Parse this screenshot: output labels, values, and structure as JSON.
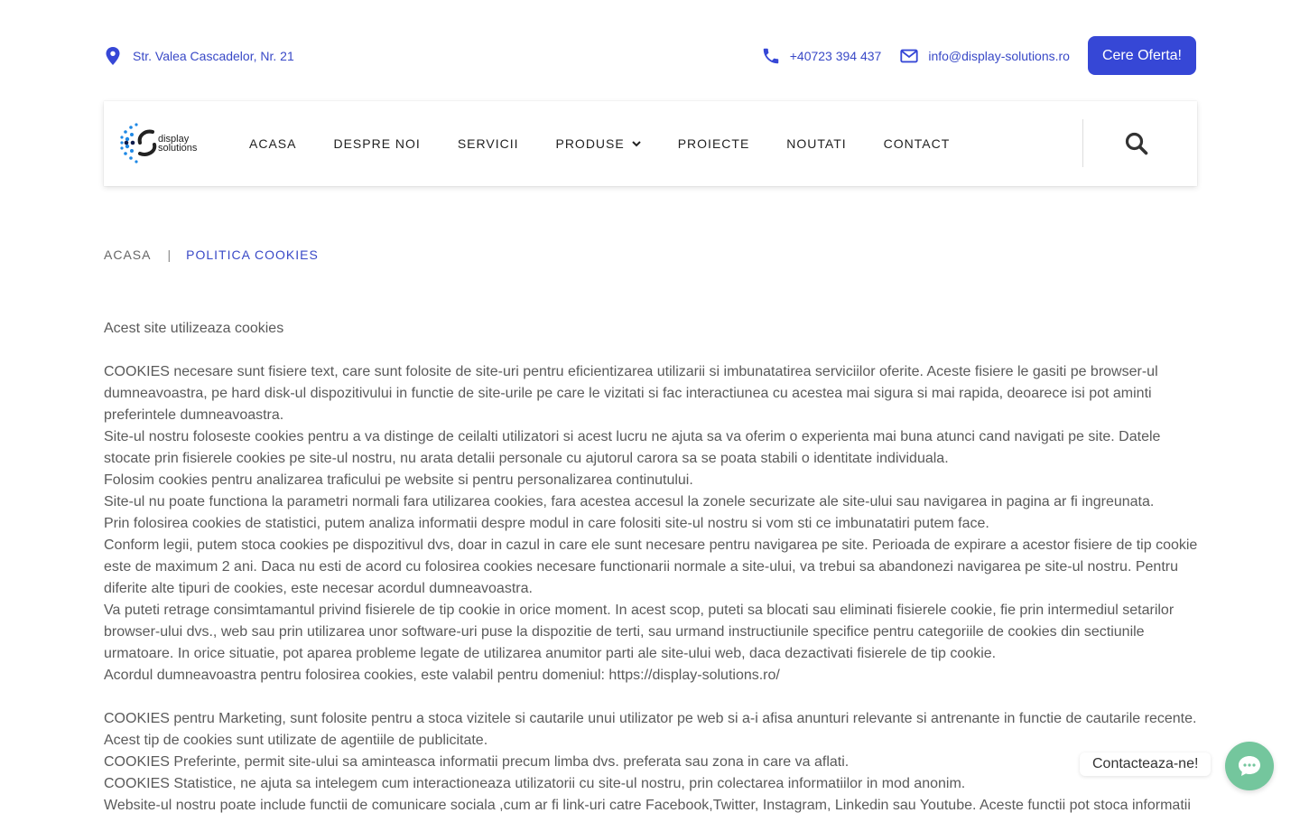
{
  "topbar": {
    "address": "Str. Valea Cascadelor, Nr. 21",
    "phone": "+40723 394 437",
    "email": "info@display-solutions.ro",
    "offer_button": "Cere Oferta!"
  },
  "logo": {
    "line1": "display",
    "line2": "solutions"
  },
  "nav": {
    "items": [
      "ACASA",
      "DESPRE NOI",
      "SERVICII",
      "PRODUSE",
      "PROIECTE",
      "NOUTATI",
      "CONTACT"
    ]
  },
  "breadcrumb": {
    "home": "ACASA",
    "separator": "|",
    "current": "POLITICA COOKIES"
  },
  "content": {
    "paragraphs": [
      "Acest site utilizeaza cookies",
      "",
      "COOKIES necesare sunt fisiere text, care sunt folosite de site-uri pentru eficientizarea utilizarii si imbunatatirea serviciilor oferite. Aceste fisiere le gasiti pe browser-ul dumneavoastra, pe hard disk-ul dispozitivului in functie de site-urile pe care le vizitati si fac interactiunea cu acestea mai sigura si mai rapida, deoarece isi pot aminti preferintele dumneavoastra.",
      "Site-ul nostru foloseste cookies pentru a va distinge de ceilalti utilizatori si acest lucru ne ajuta sa va oferim o experienta mai buna atunci cand navigati pe site. Datele stocate prin fisierele cookies pe site-ul nostru, nu arata detalii personale cu ajutorul carora sa se poata stabili o identitate individuala.",
      "Folosim cookies pentru analizarea traficului pe website si pentru personalizarea continutului.",
      "Site-ul nu poate functiona la parametri normali fara utilizarea cookies, fara acestea accesul la zonele securizate ale site-ului sau navigarea in pagina ar fi ingreunata.",
      "Prin folosirea cookies de statistici, putem analiza informatii despre modul in care folositi site-ul nostru si vom sti ce imbunatatiri putem face.",
      "Conform legii, putem stoca cookies pe dispozitivul dvs, doar in cazul in care ele sunt necesare pentru navigarea pe site. Perioada de expirare a acestor fisiere de tip cookie este de maximum 2 ani. Daca nu esti de acord cu folosirea cookies necesare functionarii normale a site-ului, va trebui sa abandonezi navigarea pe site-ul nostru. Pentru diferite alte tipuri de cookies, este necesar acordul dumneavoastra.",
      "Va puteti retrage consimtamantul privind fisierele de tip cookie in orice moment. In acest scop, puteti sa blocati sau eliminati fisierele cookie, fie prin intermediul setarilor browser-ului dvs., web sau prin utilizarea unor software-uri puse la dispozitie de terti, sau urmand instructiunile specifice pentru categoriile de cookies din sectiunile urmatoare. In orice situatie, pot aparea probleme legate de utilizarea anumitor parti ale site-ului web, daca dezactivati fisierele de tip cookie.",
      "Acordul dumneavoastra pentru folosirea cookies, este valabil pentru domeniul: https://display-solutions.ro/",
      "",
      "COOKIES pentru Marketing, sunt folosite pentru a stoca vizitele si cautarile unui utilizator pe web si a-i afisa anunturi relevante si antrenante in functie de cautarile recente. Acest tip de cookies sunt utilizate de agentiile de publicitate.",
      "COOKIES Preferinte, permit site-ului sa aminteasca informatii precum limba dvs. preferata sau zona in care va aflati.",
      "COOKIES Statistice, ne ajuta sa intelegem cum interactioneaza utilizatorii cu site-ul nostru, prin colectarea informatiilor in mod anonim.",
      "Website-ul nostru poate include functii de comunicare sociala ,cum ar fi link-uri catre Facebook,Twitter, Instagram, Linkedin sau Youtube. Aceste functii pot stoca informatii"
    ]
  },
  "chat": {
    "label": "Contacteaza-ne!"
  },
  "colors": {
    "accent": "#3647d6",
    "link": "#3949c7",
    "chat": "#74c69d"
  }
}
